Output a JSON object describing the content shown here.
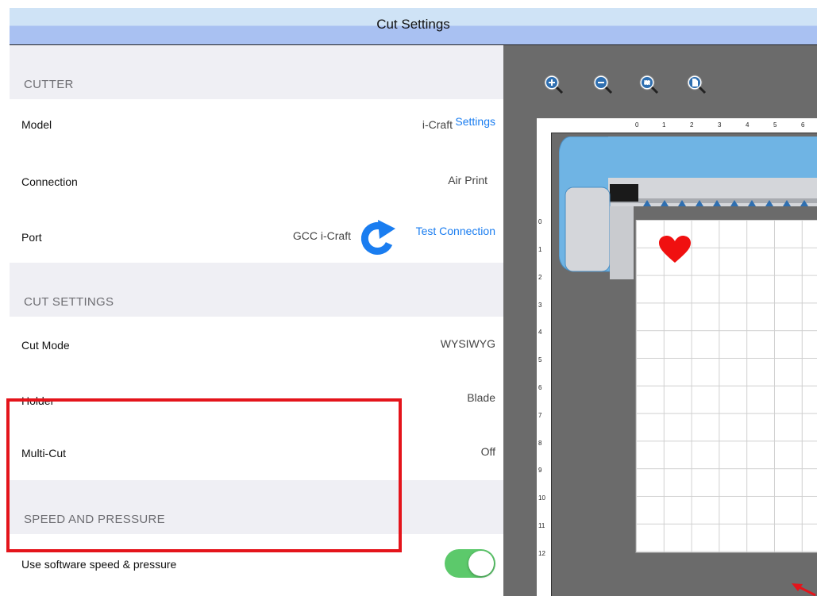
{
  "title": "Cut Settings",
  "sections": {
    "cutter": "CUTTER",
    "cut_settings": "CUT SETTINGS",
    "speed_pressure": "SPEED AND PRESSURE"
  },
  "rows": {
    "model": {
      "label": "Model",
      "value": "i-Craft",
      "link": "Settings"
    },
    "connection": {
      "label": "Connection",
      "value": "Air Print"
    },
    "port": {
      "label": "Port",
      "value": "GCC i-Craft",
      "link": "Test Connection"
    },
    "cut_mode": {
      "label": "Cut Mode",
      "value": "WYSIWYG"
    },
    "holder": {
      "label": "Holder",
      "value": "Blade"
    },
    "multi_cut": {
      "label": "Multi-Cut",
      "value": "Off"
    },
    "software_speed": {
      "label": "Use software speed & pressure",
      "toggle_on": true
    }
  },
  "preview": {
    "zoom_buttons": [
      "zoom-in-icon",
      "zoom-out-icon",
      "zoom-fit-icon",
      "zoom-page-icon"
    ],
    "ruler_top": [
      "0",
      "1",
      "2",
      "3",
      "4",
      "5",
      "6"
    ],
    "ruler_left": [
      "0",
      "1",
      "2",
      "3",
      "4",
      "5",
      "6",
      "7",
      "8",
      "9",
      "10",
      "11",
      "12"
    ],
    "shape_color": "#f01010",
    "machine_color": "#6fb4e4",
    "highlight_color": "#e4141b",
    "accent_color": "#1a7df0",
    "toggle_color": "#5cc96b"
  }
}
